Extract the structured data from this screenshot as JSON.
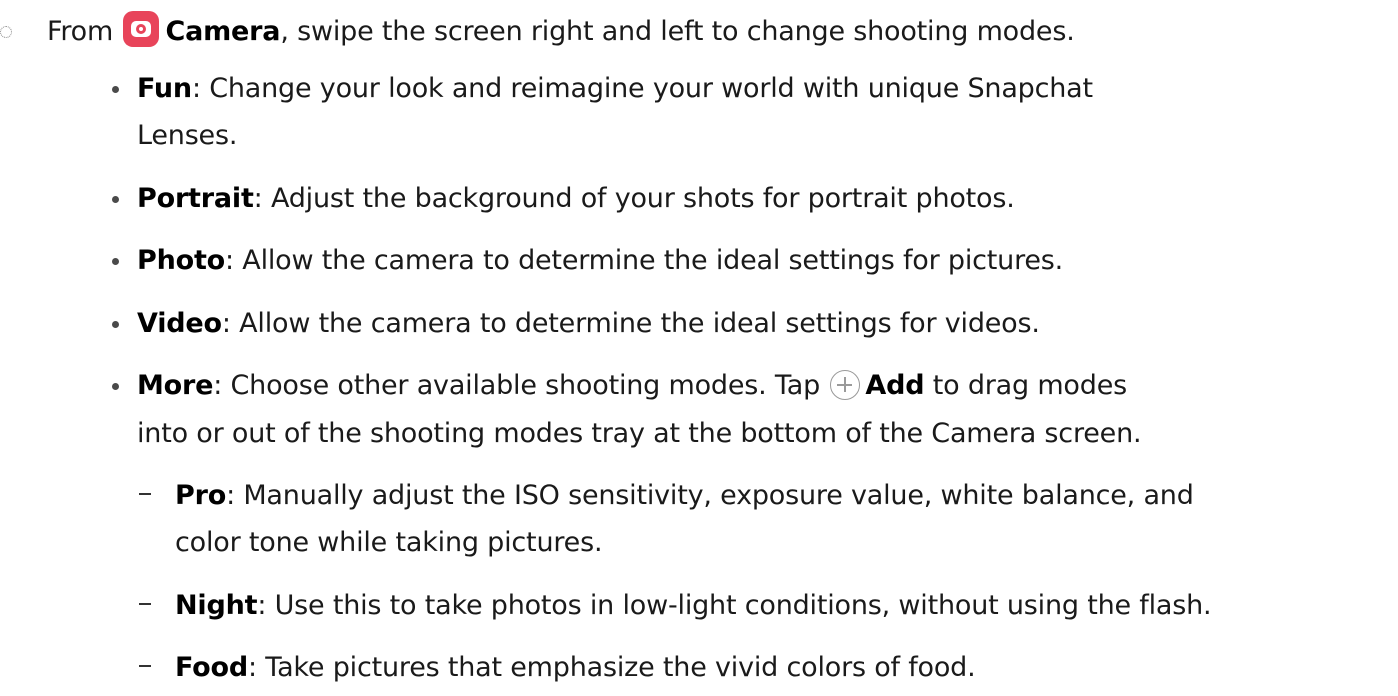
{
  "step": {
    "before_icon": "From",
    "app_name": "Camera",
    "after_app": ", swipe the screen right and left to change shooting modes.",
    "icon": "camera-app-icon",
    "icon_color": "#e8445a"
  },
  "modes": [
    {
      "label": "Fun",
      "desc_line1": ": Change your look and reimagine your world with unique Snapchat",
      "desc_line2": "Lenses."
    },
    {
      "label": "Portrait",
      "desc": ": Adjust the background of your shots for portrait photos."
    },
    {
      "label": "Photo",
      "desc": ": Allow the camera to determine the ideal settings for pictures."
    },
    {
      "label": "Video",
      "desc": ": Allow the camera to determine the ideal settings for videos."
    },
    {
      "label": "More",
      "desc_before_icon": ": Choose other available shooting modes. Tap",
      "add_label": "Add",
      "desc_after_add": " to drag modes",
      "desc_line2": "into or out of the shooting modes tray at the bottom of the Camera screen.",
      "icon": "add-circle-icon"
    }
  ],
  "more_modes": [
    {
      "label": "Pro",
      "desc_line1": ": Manually adjust the ISO sensitivity, exposure value, white balance, and",
      "desc_line2": "color tone while taking pictures."
    },
    {
      "label": "Night",
      "desc": ": Use this to take photos in low-light conditions, without using the flash."
    },
    {
      "label": "Food",
      "desc": ": Take pictures that emphasize the vivid colors of food."
    }
  ]
}
